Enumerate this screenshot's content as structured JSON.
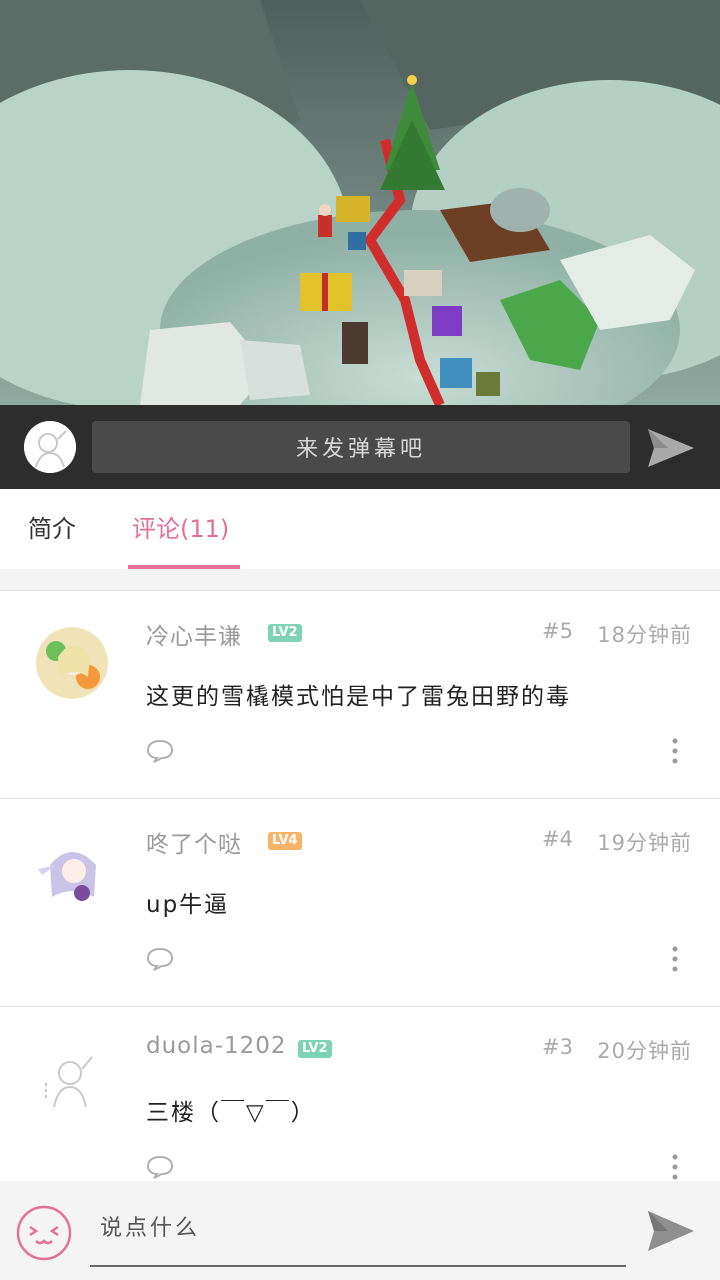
{
  "danmaku": {
    "placeholder": "来发弹幕吧",
    "send_icon": "send-icon"
  },
  "tabs": [
    {
      "label": "简介",
      "active": false
    },
    {
      "label": "评论(11)",
      "active": true
    }
  ],
  "colors": {
    "accent": "#e4709a",
    "lv2": "#7fd3b5",
    "lv4": "#f7b368",
    "danmaku_bar": "#2d2d2d"
  },
  "comments": [
    {
      "username": "冷心丰谦",
      "level": "LV2",
      "floor": "#5",
      "time": "18分钟前",
      "text": "这更的雪橇模式怕是中了雷兔田野的毒"
    },
    {
      "username": "咚了个哒",
      "level": "LV4",
      "floor": "#4",
      "time": "19分钟前",
      "text": "up牛逼"
    },
    {
      "username": "duola-1202",
      "level": "LV2",
      "floor": "#3",
      "time": "20分钟前",
      "text": "三楼（￣▽￣）"
    }
  ],
  "bottom": {
    "placeholder": "说点什么",
    "emoji_icon": "emoji-face-icon",
    "send_icon": "send-icon"
  }
}
